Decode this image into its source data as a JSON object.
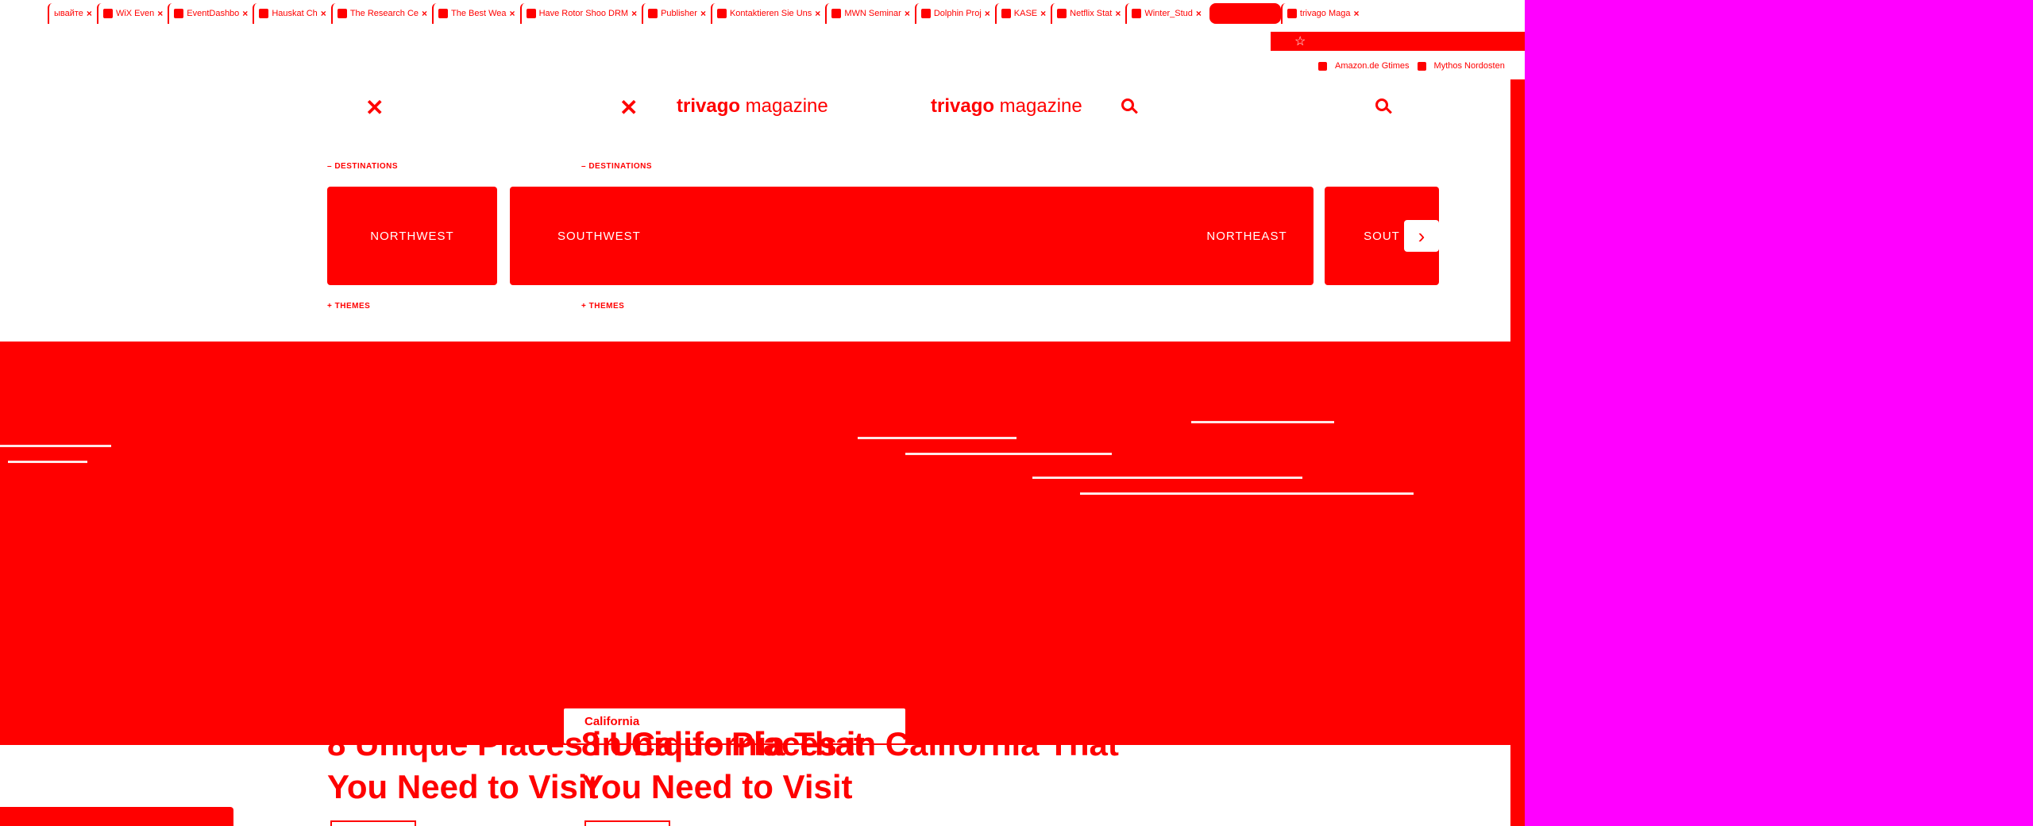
{
  "tabs": [
    {
      "label": "ывайте",
      "active": false
    },
    {
      "label": "WiX Even",
      "active": false
    },
    {
      "label": "EventDashbo",
      "active": false
    },
    {
      "label": "Hauskat Ch",
      "active": false
    },
    {
      "label": "The Research Ce",
      "active": false
    },
    {
      "label": "The Best Wea",
      "active": false
    },
    {
      "label": "Have Rotor Shoo DRM",
      "active": false
    },
    {
      "label": "Publisher",
      "active": false
    },
    {
      "label": "Kontaktieren Sie Uns",
      "active": false
    },
    {
      "label": "MWN Seminar",
      "active": false
    },
    {
      "label": "Dolphin Proj",
      "active": false
    },
    {
      "label": "KASE",
      "active": false
    },
    {
      "label": "Netflix Stat",
      "active": false
    },
    {
      "label": "Winter_Stud",
      "active": false
    },
    {
      "label": "trivago Maga",
      "active": true
    }
  ],
  "addressbar": {
    "star_icon": "star-icon"
  },
  "bookmarks": [
    {
      "label": "Amazon.de Gtimes"
    },
    {
      "label": "Mythos Nordosten"
    }
  ],
  "header": {
    "logo_bold": "trivago",
    "logo_rest": " magazine"
  },
  "sections": {
    "destinations": "– DESTINATIONS",
    "themes": "+ THEMES"
  },
  "destinations": [
    {
      "label": "NORTHWEST"
    },
    {
      "label": "SOUTHWEST"
    },
    {
      "label": "NORTHEAST"
    },
    {
      "label": "SOUT"
    }
  ],
  "article": {
    "category": "California",
    "title_line1": "8 Unique Places in California That",
    "title_line2": "You Need to Visit"
  },
  "colors": {
    "primary": "#ff0000",
    "background": "#ffffff",
    "outside": "#ff00ff"
  }
}
